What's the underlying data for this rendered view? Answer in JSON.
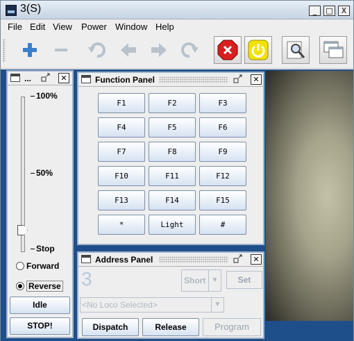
{
  "window": {
    "title": "3(S)",
    "minimize_glyph": "_",
    "maximize_glyph": "□",
    "close_glyph": "X"
  },
  "menu": [
    "File",
    "Edit",
    "View",
    "Power",
    "Window",
    "Help"
  ],
  "toolbar": {
    "icons": [
      "add-icon",
      "remove-icon",
      "undo-icon",
      "back-icon",
      "forward-icon",
      "redo-icon",
      "stop-icon",
      "power-icon",
      "inspect-icon",
      "windows-icon"
    ],
    "colors": {
      "add": "#3a7fd0",
      "stop": "#d81e1e",
      "power": "#f2e200"
    }
  },
  "throttle_panel": {
    "title": "...",
    "tick_labels": [
      "100%",
      "50%",
      "Stop"
    ],
    "speed_fraction": 0.0,
    "direction_options": [
      "Forward",
      "Reverse"
    ],
    "selected_direction": "Reverse",
    "idle_label": "Idle",
    "stop_label": "STOP!"
  },
  "function_panel": {
    "title": "Function Panel",
    "buttons": [
      "F1",
      "F2",
      "F3",
      "F4",
      "F5",
      "F6",
      "F7",
      "F8",
      "F9",
      "F10",
      "F11",
      "F12",
      "F13",
      "F14",
      "F15",
      "*",
      "Light",
      "#"
    ]
  },
  "address_panel": {
    "title": "Address Panel",
    "address": "3",
    "address_type": "Short",
    "set_label": "Set",
    "roster_placeholder": "<No Loco Selected>",
    "dispatch_label": "Dispatch",
    "release_label": "Release",
    "program_label": "Program"
  }
}
